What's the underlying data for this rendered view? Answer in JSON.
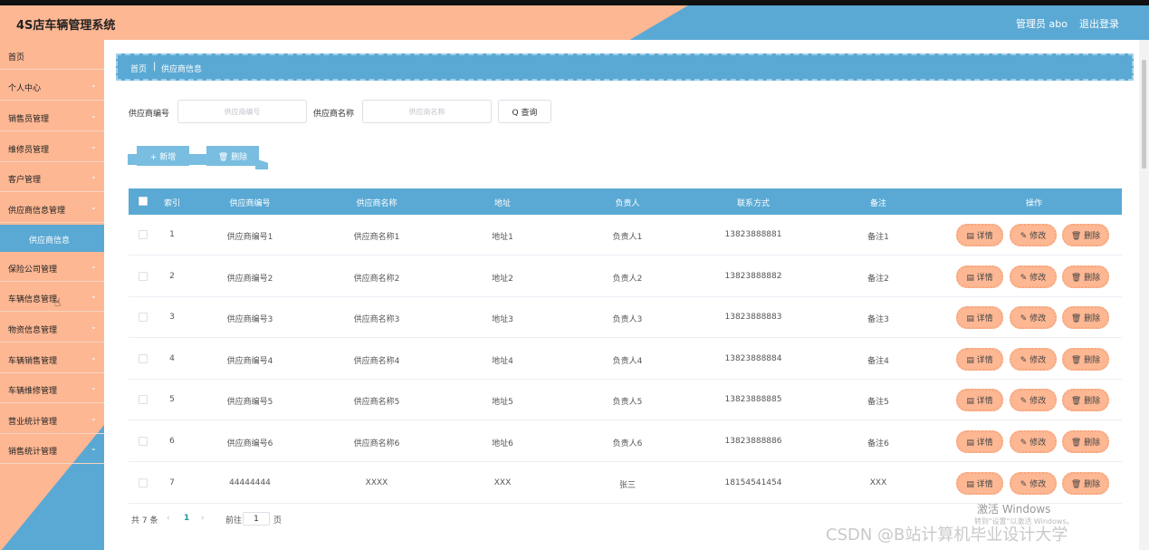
{
  "header": {
    "title": "4S店车辆管理系统",
    "user": "管理员 abo",
    "logout": "退出登录"
  },
  "sidebar": {
    "items": [
      {
        "label": "首页",
        "chevron": false
      },
      {
        "label": "个人中心",
        "chevron": true
      },
      {
        "label": "销售员管理",
        "chevron": true
      },
      {
        "label": "维修员管理",
        "chevron": true
      },
      {
        "label": "客户管理",
        "chevron": true
      },
      {
        "label": "供应商信息管理",
        "chevron": true
      },
      {
        "label": "保险公司管理",
        "chevron": true
      },
      {
        "label": "车辆信息管理",
        "chevron": true
      },
      {
        "label": "物资信息管理",
        "chevron": true
      },
      {
        "label": "车辆销售管理",
        "chevron": true
      },
      {
        "label": "车辆维修管理",
        "chevron": true
      },
      {
        "label": "营业统计管理",
        "chevron": true
      },
      {
        "label": "销售统计管理",
        "chevron": true
      }
    ],
    "active_sub": "供应商信息",
    "chevron_glyph": "⌄"
  },
  "breadcrumb": {
    "home": "首页",
    "separator": "|",
    "current": "供应商信息"
  },
  "search": {
    "code_label": "供应商编号",
    "code_placeholder": "供应商编号",
    "code_value": "",
    "name_label": "供应商名称",
    "name_placeholder": "供应商名称",
    "name_value": "",
    "query_label": "Q 查询"
  },
  "actions": {
    "add_label": "+ 新增",
    "delete_label": "🗑 删除"
  },
  "table": {
    "columns": [
      "索引",
      "供应商编号",
      "供应商名称",
      "地址",
      "负责人",
      "联系方式",
      "备注",
      "操作"
    ],
    "rows": [
      {
        "index": "1",
        "code": "供应商编号1",
        "name": "供应商名称1",
        "address": "地址1",
        "manager": "负责人1",
        "phone": "13823888881",
        "remark": "备注1"
      },
      {
        "index": "2",
        "code": "供应商编号2",
        "name": "供应商名称2",
        "address": "地址2",
        "manager": "负责人2",
        "phone": "13823888882",
        "remark": "备注2"
      },
      {
        "index": "3",
        "code": "供应商编号3",
        "name": "供应商名称3",
        "address": "地址3",
        "manager": "负责人3",
        "phone": "13823888883",
        "remark": "备注3"
      },
      {
        "index": "4",
        "code": "供应商编号4",
        "name": "供应商名称4",
        "address": "地址4",
        "manager": "负责人4",
        "phone": "13823888884",
        "remark": "备注4"
      },
      {
        "index": "5",
        "code": "供应商编号5",
        "name": "供应商名称5",
        "address": "地址5",
        "manager": "负责人5",
        "phone": "13823888885",
        "remark": "备注5"
      },
      {
        "index": "6",
        "code": "供应商编号6",
        "name": "供应商名称6",
        "address": "地址6",
        "manager": "负责人6",
        "phone": "13823888886",
        "remark": "备注6"
      },
      {
        "index": "7",
        "code": "44444444",
        "name": "XXXX",
        "address": "XXX",
        "manager": "张三",
        "phone": "18154541454",
        "remark": "XXX"
      }
    ],
    "op_detail": "▤ 详情",
    "op_edit": "✎ 修改",
    "op_delete": "🗑 删除"
  },
  "pagination": {
    "total": "共 7 条",
    "prev": "‹",
    "page": "1",
    "next": "›",
    "goto": "前往",
    "goto_value": "1",
    "page_suffix": "页"
  },
  "watermark": {
    "activate": "激活 Windows",
    "activate_sub": "转到\"设置\"以激活 Windows。",
    "csdn": "CSDN @B站计算机毕业设计大学"
  },
  "colors": {
    "accent_blue": "#5aa9d4",
    "accent_peach": "#fdb793"
  }
}
